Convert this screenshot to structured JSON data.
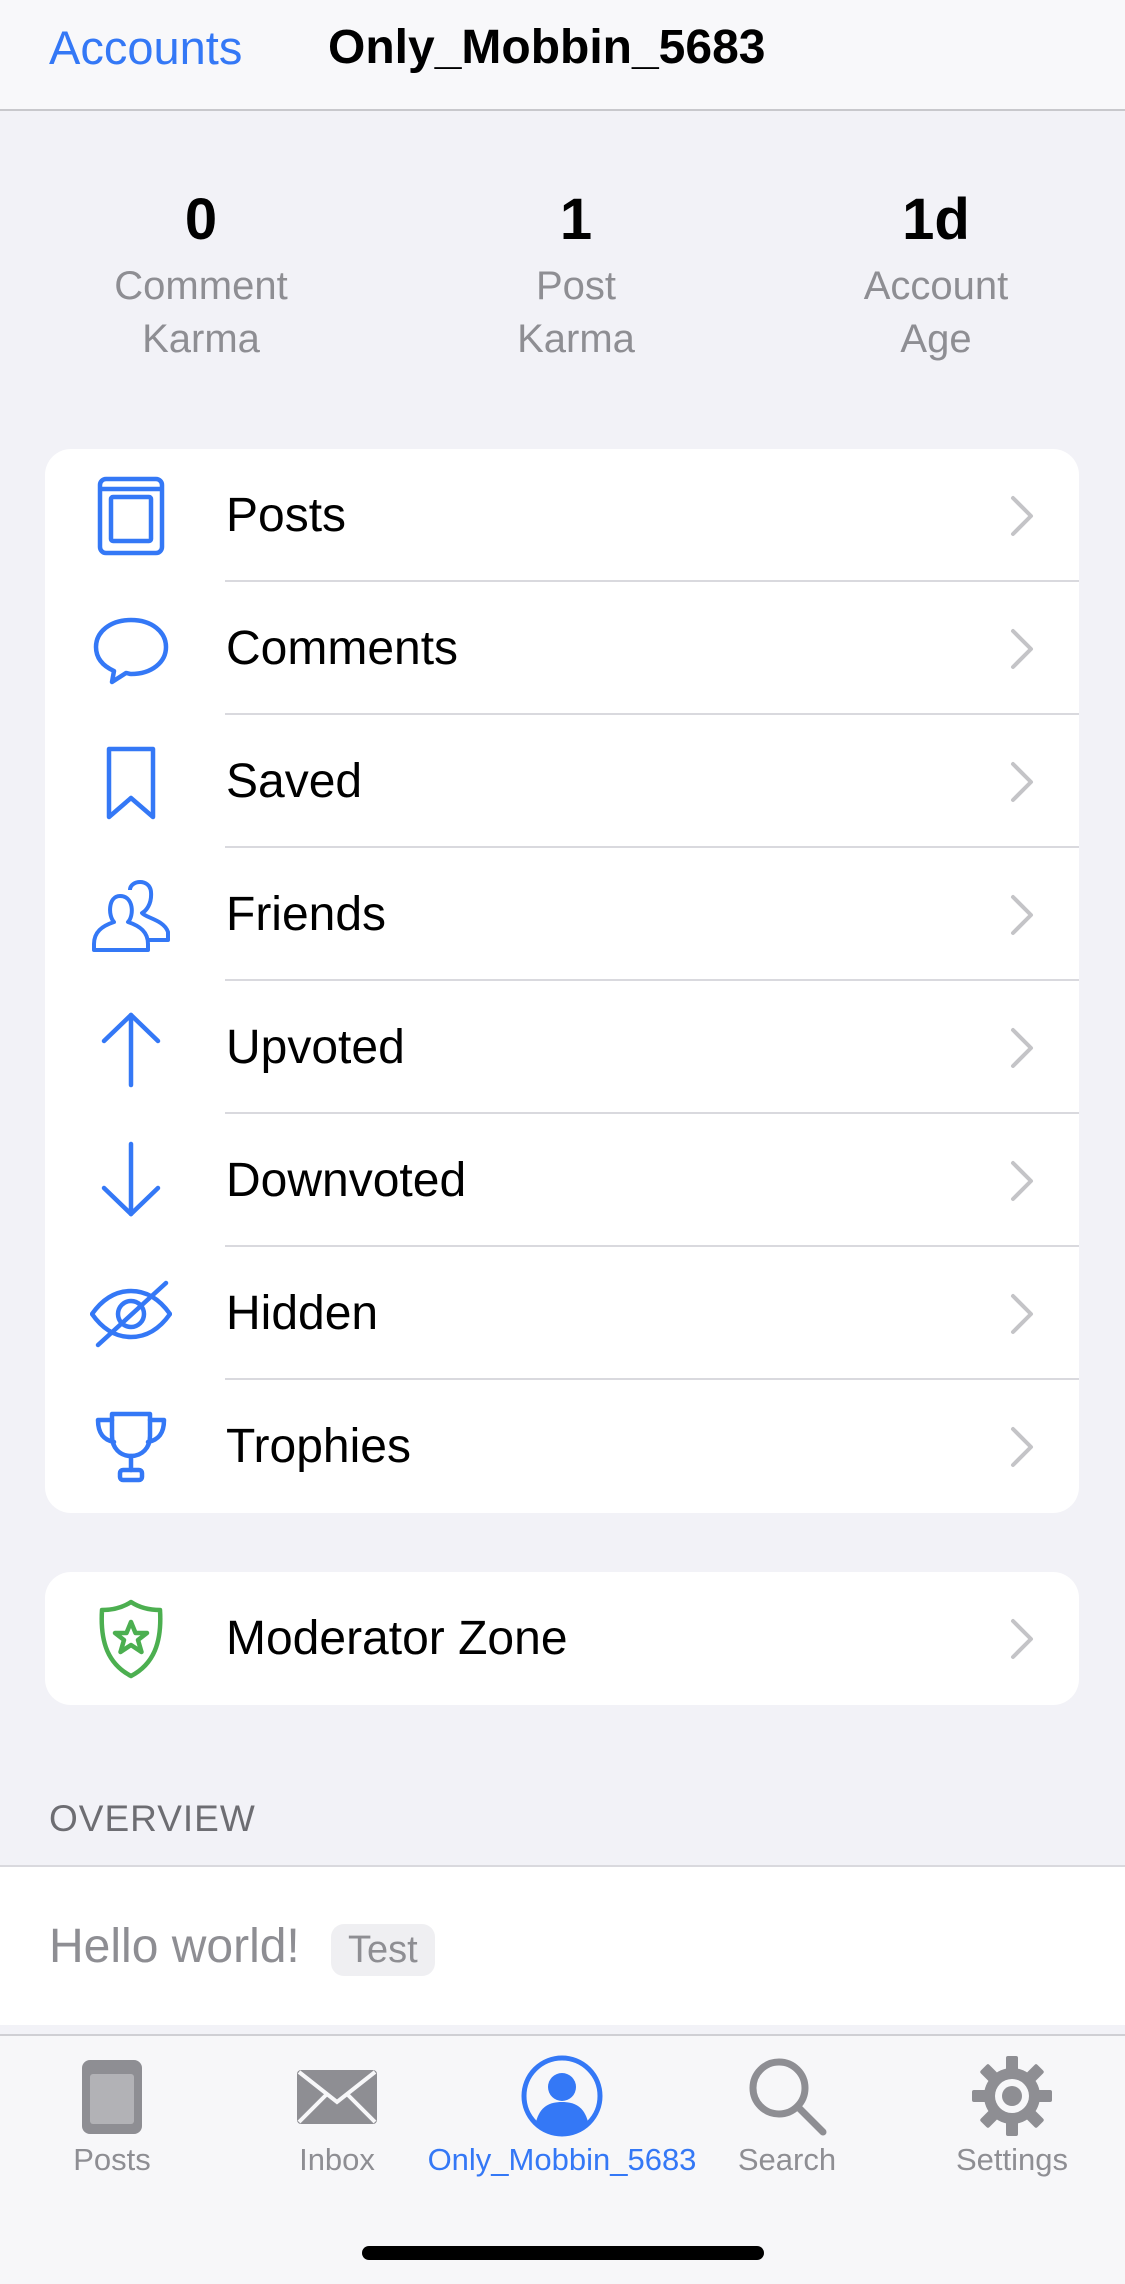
{
  "nav": {
    "back_label": "Accounts",
    "title": "Only_Mobbin_5683"
  },
  "stats": [
    {
      "value": "0",
      "label": "Comment\nKarma"
    },
    {
      "value": "1",
      "label": "Post\nKarma"
    },
    {
      "value": "1d",
      "label": "Account\nAge"
    }
  ],
  "menu": [
    {
      "label": "Posts",
      "icon": "posts-icon"
    },
    {
      "label": "Comments",
      "icon": "speech-bubble-icon"
    },
    {
      "label": "Saved",
      "icon": "bookmark-icon"
    },
    {
      "label": "Friends",
      "icon": "people-icon"
    },
    {
      "label": "Upvoted",
      "icon": "arrow-up-icon"
    },
    {
      "label": "Downvoted",
      "icon": "arrow-down-icon"
    },
    {
      "label": "Hidden",
      "icon": "eye-slash-icon"
    },
    {
      "label": "Trophies",
      "icon": "trophy-icon"
    }
  ],
  "moderator": {
    "label": "Moderator Zone",
    "icon": "shield-star-icon"
  },
  "overview": {
    "header": "OVERVIEW",
    "post_title": "Hello world!",
    "flair": "Test"
  },
  "tabs": [
    {
      "label": "Posts",
      "icon": "posts-tab-icon",
      "active": false
    },
    {
      "label": "Inbox",
      "icon": "envelope-icon",
      "active": false
    },
    {
      "label": "Only_Mobbin_5683",
      "icon": "person-circle-icon",
      "active": true
    },
    {
      "label": "Search",
      "icon": "magnifier-icon",
      "active": false
    },
    {
      "label": "Settings",
      "icon": "gear-icon",
      "active": false
    }
  ],
  "colors": {
    "accent": "#3478f6",
    "moderator_green": "#4caf50",
    "secondary_text": "#8e8e93",
    "background": "#f2f2f7"
  }
}
